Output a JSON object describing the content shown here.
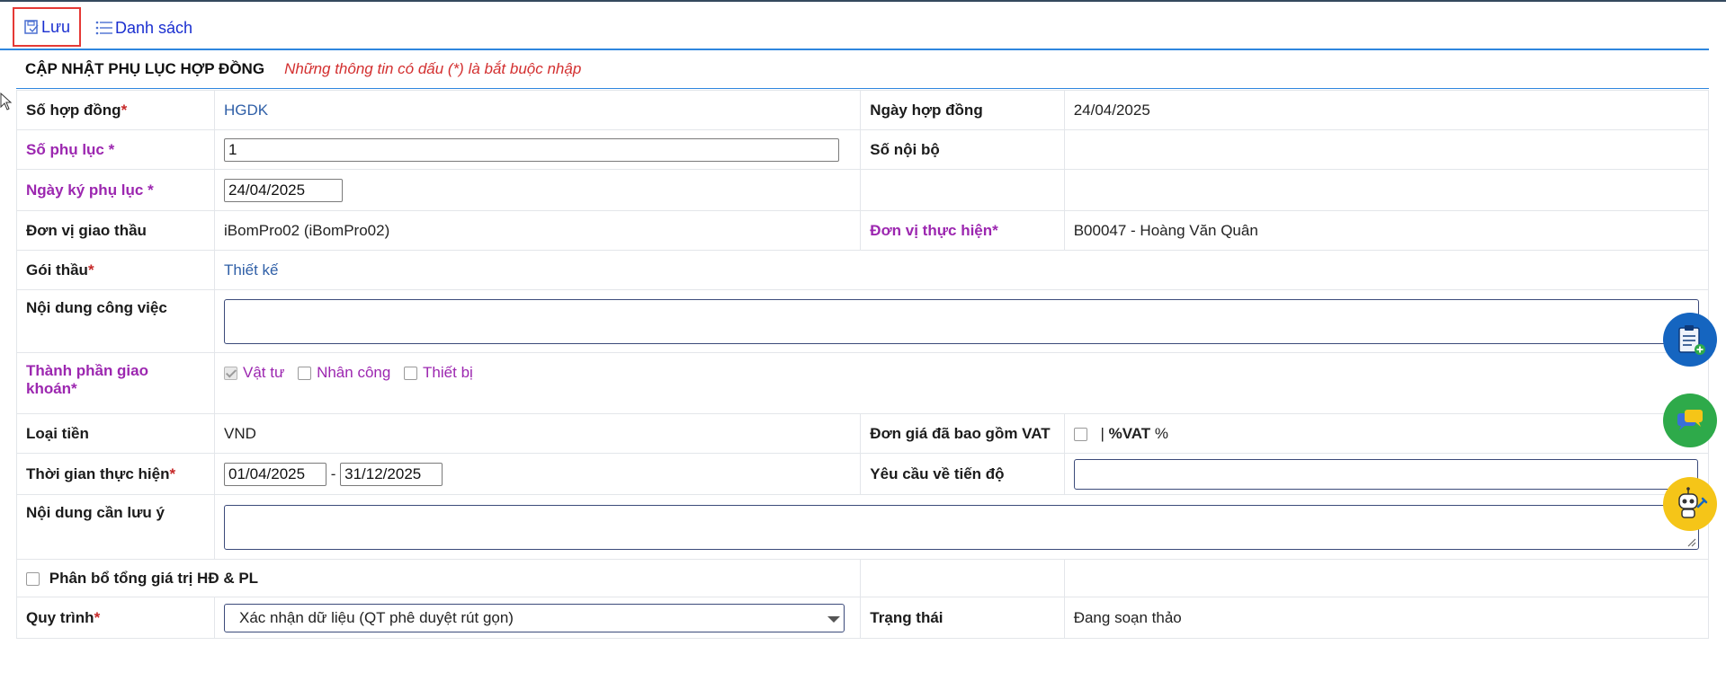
{
  "toolbar": {
    "save_label": "Lưu",
    "list_label": "Danh sách"
  },
  "section": {
    "title": "CẬP NHẬT PHỤ LỤC HỢP ĐỒNG",
    "note": "Những thông tin có dấu (*) là bắt buộc nhập"
  },
  "form": {
    "contract_no": {
      "label": "Số hợp đồng",
      "star": "*",
      "value": "HGDK"
    },
    "contract_date": {
      "label": "Ngày hợp đồng",
      "value": "24/04/2025"
    },
    "appendix_no": {
      "label": "Số phụ lục *",
      "value": "1"
    },
    "internal_no": {
      "label": "Số nội bộ"
    },
    "appendix_sign_date": {
      "label": "Ngày ký phụ lục *",
      "value": "24/04/2025"
    },
    "assigning_unit": {
      "label": "Đơn vị giao thầu",
      "value": "iBomPro02 (iBomPro02)"
    },
    "executing_unit": {
      "label": "Đơn vị thực hiện*",
      "value": "B00047 - Hoàng Văn Quân"
    },
    "package": {
      "label": "Gói thầu",
      "star": "*",
      "value": "Thiết kế"
    },
    "work_content": {
      "label": "Nội dung công việc"
    },
    "components": {
      "label_line1": "Thành phần giao",
      "label_line2": "khoán*",
      "options": [
        {
          "label": "Vật tư",
          "checked": true
        },
        {
          "label": "Nhân công",
          "checked": false
        },
        {
          "label": "Thiết bị",
          "checked": false
        }
      ]
    },
    "currency": {
      "label": "Loại tiền",
      "value": "VND"
    },
    "vat_included": {
      "label": "Đơn giá đã bao gồm VAT",
      "sep": "|",
      "vat_label": "%VAT",
      "pct": "%"
    },
    "period": {
      "label": "Thời gian thực hiện",
      "star": "*",
      "from": "01/04/2025",
      "dash": "-",
      "to": "31/12/2025"
    },
    "progress_req": {
      "label": "Yêu cầu về tiến độ"
    },
    "notes": {
      "label": "Nội dung cần lưu ý"
    },
    "allocate": {
      "label": "Phân bổ tổng giá trị HĐ & PL",
      "checked": false
    },
    "workflow": {
      "label": "Quy trình",
      "star": "*",
      "value": "Xác nhận dữ liệu (QT phê duyệt rút gọn)"
    },
    "status": {
      "label": "Trạng thái",
      "value": "Đang soạn thảo"
    }
  },
  "floating": {
    "icons": [
      "clipboard-add-icon",
      "chat-icon",
      "robot-support-icon"
    ],
    "colors": {
      "blue": "#1565c0",
      "green": "#2eaa4a",
      "yellow": "#f5c518"
    }
  },
  "colors": {
    "accent": "#2e86de",
    "required": "#9c27b0",
    "link": "#2f5fa7",
    "error_note": "#d32f2f",
    "save_border": "#e53935"
  }
}
